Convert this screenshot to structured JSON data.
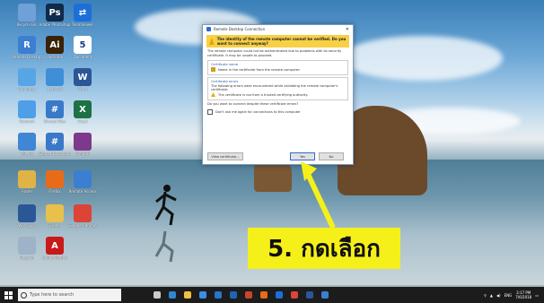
{
  "desktop": {
    "icons": [
      {
        "label": "Recycle Bin",
        "icon": "recycle-bin-icon",
        "color": "#6fa0d6",
        "glyph": ""
      },
      {
        "label": "Adobe Photoshop",
        "icon": "photoshop-icon",
        "color": "#0f2a4a",
        "glyph": "Ps"
      },
      {
        "label": "TeamViewer",
        "icon": "teamviewer-icon",
        "color": "#1d6fd8",
        "glyph": "⇄"
      },
      {
        "label": "Remote Desktop",
        "icon": "remote-icon",
        "color": "#3c7fd1",
        "glyph": "R"
      },
      {
        "label": "Illustrator",
        "icon": "illustrator-icon",
        "color": "#3a2207",
        "glyph": "Ai"
      },
      {
        "label": "Document",
        "icon": "document-icon",
        "color": "#ffffff",
        "glyph": "5"
      },
      {
        "label": "Computer",
        "icon": "computer-icon",
        "color": "#56a6e6",
        "glyph": ""
      },
      {
        "label": "Network",
        "icon": "network-icon",
        "color": "#3f8fd7",
        "glyph": ""
      },
      {
        "label": "Word",
        "icon": "word-icon",
        "color": "#2b5797",
        "glyph": "W"
      },
      {
        "label": "Network",
        "icon": "network2-icon",
        "color": "#4f9ee8",
        "glyph": ""
      },
      {
        "label": "Shared Files",
        "icon": "shared-icon",
        "color": "#3a78c9",
        "glyph": "#"
      },
      {
        "label": "Excel",
        "icon": "excel-icon",
        "color": "#1e7145",
        "glyph": "X"
      },
      {
        "label": "This PC",
        "icon": "this-pc-icon",
        "color": "#3f86d4",
        "glyph": ""
      },
      {
        "label": "Shared Download",
        "icon": "shared-download-icon",
        "color": "#3a78c9",
        "glyph": "#"
      },
      {
        "label": "WinRAR",
        "icon": "winrar-icon",
        "color": "#7d3a8c",
        "glyph": ""
      },
      {
        "label": "Folder",
        "icon": "folder-user-icon",
        "color": "#e0b347",
        "glyph": ""
      },
      {
        "label": "Firefox",
        "icon": "firefox-icon",
        "color": "#e86b1a",
        "glyph": ""
      },
      {
        "label": "Remote Access",
        "icon": "remote-access-icon",
        "color": "#3c7fd1",
        "glyph": ""
      },
      {
        "label": "Word Doc",
        "icon": "word-doc-icon",
        "color": "#2b5797",
        "glyph": ""
      },
      {
        "label": "Folder",
        "icon": "folder-icon",
        "color": "#e8c04a",
        "glyph": ""
      },
      {
        "label": "Google Chrome",
        "icon": "chrome-icon",
        "color": "#db4437",
        "glyph": ""
      },
      {
        "label": "Recycle",
        "icon": "recycle-icon",
        "color": "#9fb3c8",
        "glyph": ""
      },
      {
        "label": "Adobe Reader",
        "icon": "acrobat-icon",
        "color": "#c81a1a",
        "glyph": "A"
      }
    ]
  },
  "dialog": {
    "title": "Remote Desktop Connection",
    "warning": "The identity of the remote computer cannot be verified. Do you want to connect anyway?",
    "intro": "The remote computer could not be authenticated due to problems with its security certificate. It may be unsafe to proceed.",
    "cert_name_heading": "Certificate name",
    "cert_name_text": "Name in the certificate from the remote computer:",
    "cert_errors_heading": "Certificate errors",
    "cert_errors_text": "The following errors were encountered while validating the remote computer's certificate:",
    "cert_error_item": "The certificate is not from a trusted certifying authority.",
    "question": "Do you want to connect despite these certificate errors?",
    "checkbox_label": "Don't ask me again for connections to this computer",
    "view_cert_label": "View certificate...",
    "yes_label": "Yes",
    "no_label": "No"
  },
  "callout": {
    "text": "5. กดเลือก",
    "bg_color": "#f5f01a",
    "arrow_color": "#f5f01a"
  },
  "taskbar": {
    "search_placeholder": "Type here to search",
    "apps": [
      {
        "icon": "task-view-icon",
        "color": "#cccccc"
      },
      {
        "icon": "edge-icon",
        "color": "#2f86d4"
      },
      {
        "icon": "file-explorer-icon",
        "color": "#f0c040"
      },
      {
        "icon": "store-icon",
        "color": "#3a8ee6"
      },
      {
        "icon": "mail-icon",
        "color": "#2a74c9"
      },
      {
        "icon": "outlook-icon",
        "color": "#1f63b8"
      },
      {
        "icon": "powerpoint-icon",
        "color": "#c9452c"
      },
      {
        "icon": "firefox-taskbar-icon",
        "color": "#e86b1a"
      },
      {
        "icon": "teamviewer-taskbar-icon",
        "color": "#1d6fd8"
      },
      {
        "icon": "chrome-taskbar-icon",
        "color": "#db4437"
      },
      {
        "icon": "word-taskbar-icon",
        "color": "#2b5797"
      },
      {
        "icon": "remote-desktop-taskbar-icon",
        "color": "#3c7fd1"
      }
    ],
    "lang": "ENG",
    "time": "3:17 PM",
    "date": "7/6/2018"
  }
}
